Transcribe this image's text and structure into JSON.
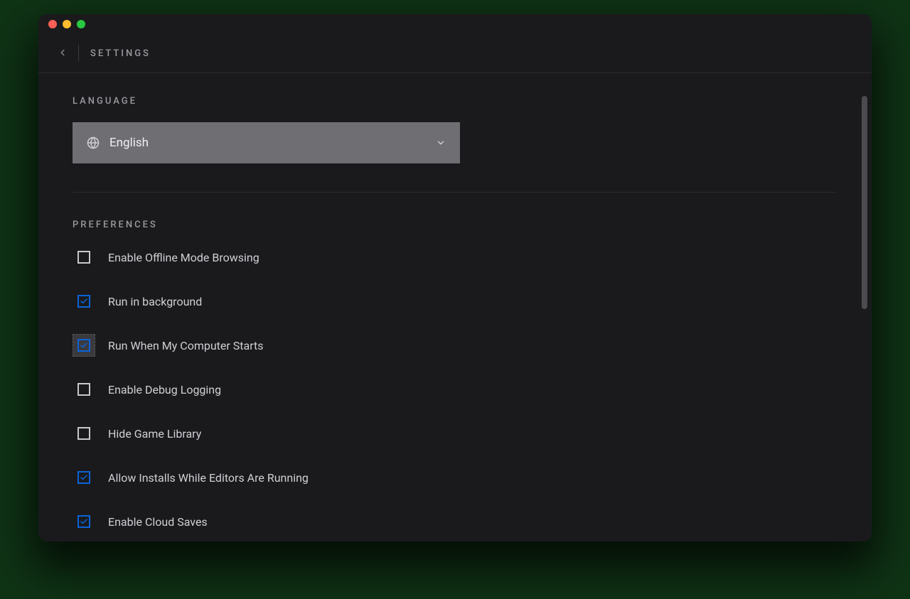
{
  "header": {
    "title": "SETTINGS"
  },
  "sections": {
    "language": {
      "heading": "LANGUAGE",
      "selected": "English"
    },
    "preferences": {
      "heading": "PREFERENCES",
      "items": [
        {
          "label": "Enable Offline Mode Browsing",
          "checked": false,
          "focused": false
        },
        {
          "label": "Run in background",
          "checked": true,
          "focused": false
        },
        {
          "label": "Run When My Computer Starts",
          "checked": true,
          "focused": true
        },
        {
          "label": "Enable Debug Logging",
          "checked": false,
          "focused": false
        },
        {
          "label": "Hide Game Library",
          "checked": false,
          "focused": false
        },
        {
          "label": "Allow Installs While Editors Are Running",
          "checked": true,
          "focused": false
        },
        {
          "label": "Enable Cloud Saves",
          "checked": true,
          "focused": false
        }
      ]
    }
  }
}
